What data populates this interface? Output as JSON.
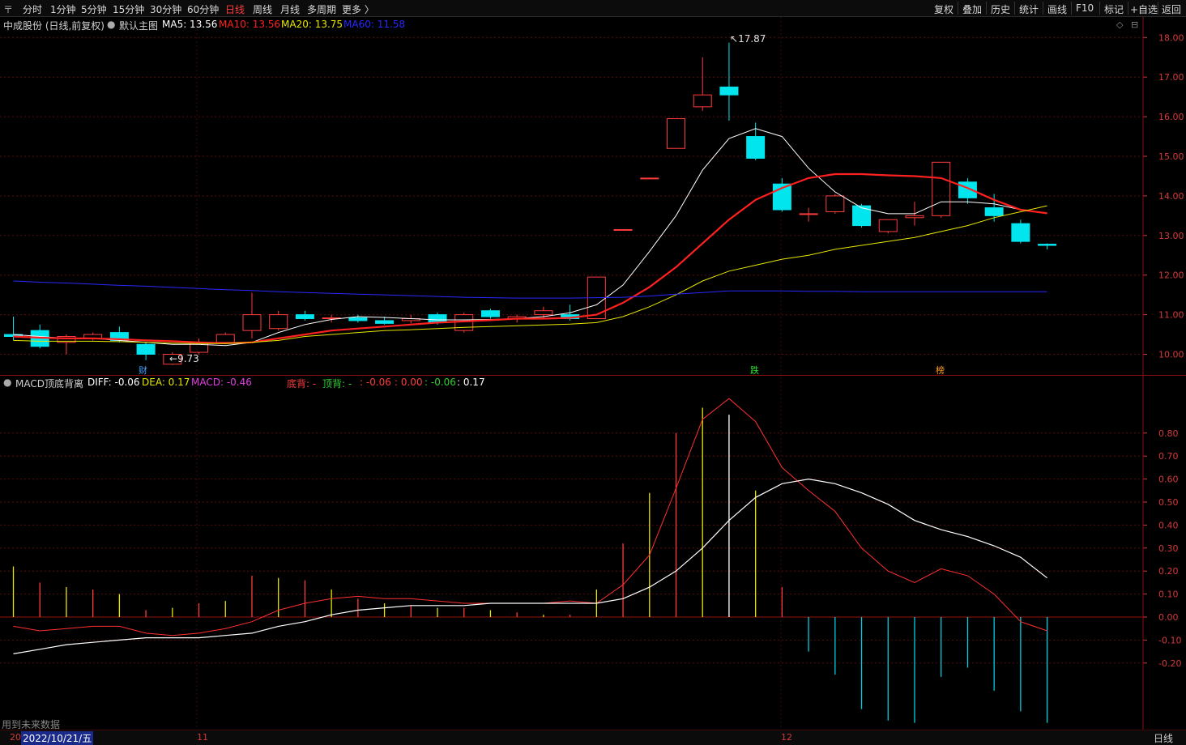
{
  "toolbar": {
    "menu_icon": "〒",
    "periods": [
      "分时",
      "1分钟",
      "5分钟",
      "15分钟",
      "30分钟",
      "60分钟",
      "日线",
      "周线",
      "月线",
      "多周期",
      "更多 〉"
    ],
    "active_period": "日线",
    "right_buttons": [
      "复权",
      "叠加",
      "历史",
      "统计",
      "画线",
      "F10",
      "标记",
      "+自选",
      "返回"
    ]
  },
  "main_legend": {
    "stock": "中成股份 (日线,前复权)",
    "template": "默认主图",
    "ma5": "MA5: 13.56",
    "ma10": "MA10: 13.56",
    "ma20": "MA20: 13.75",
    "ma60": "MA60: 11.58"
  },
  "macd_legend": {
    "name": "MACD顶底背离",
    "diff": "DIFF: -0.06",
    "dea": "DEA: 0.17",
    "macd": "MACD: -0.46",
    "bottom_div": "底背: -",
    "top_div": "顶背: -",
    "v1": ": -0.06",
    "v2": ": 0.00",
    "v3": ": -0.06",
    "v4": ": 0.17"
  },
  "annotations": {
    "high": "17.87",
    "low": "9.73",
    "badge1": "财",
    "badge2": "跌",
    "badge3": "榜"
  },
  "footer": {
    "note": "用到未来数据",
    "date_label": "2022/10/21/五",
    "month_11": "11",
    "month_12": "12",
    "period": "日线",
    "left_mark": "20"
  },
  "colors": {
    "up": "#ff3c3c",
    "down": "#00e5ee",
    "ma5": "#ffffff",
    "ma10": "#ff2020",
    "ma20": "#e6e600",
    "ma60": "#2828ff",
    "axis": "#d43a3a"
  },
  "chart_data": [
    {
      "type": "candlestick",
      "title": "中成股份 (日线,前复权)",
      "ylim": [
        9.6,
        18.2
      ],
      "y_ticks": [
        10.0,
        11.0,
        12.0,
        13.0,
        14.0,
        15.0,
        16.0,
        17.0,
        18.0
      ],
      "candles": [
        {
          "o": 10.5,
          "h": 10.95,
          "l": 10.35,
          "c": 10.45
        },
        {
          "o": 10.6,
          "h": 10.75,
          "l": 10.15,
          "c": 10.2
        },
        {
          "o": 10.3,
          "h": 10.5,
          "l": 10.0,
          "c": 10.45
        },
        {
          "o": 10.4,
          "h": 10.55,
          "l": 10.35,
          "c": 10.5
        },
        {
          "o": 10.55,
          "h": 10.7,
          "l": 10.3,
          "c": 10.35
        },
        {
          "o": 10.25,
          "h": 10.3,
          "l": 9.85,
          "c": 10.0
        },
        {
          "o": 9.75,
          "h": 10.05,
          "l": 9.73,
          "c": 10.0
        },
        {
          "o": 10.05,
          "h": 10.4,
          "l": 10.0,
          "c": 10.3
        },
        {
          "o": 10.3,
          "h": 10.55,
          "l": 10.25,
          "c": 10.5
        },
        {
          "o": 10.6,
          "h": 11.55,
          "l": 10.4,
          "c": 11.0
        },
        {
          "o": 10.65,
          "h": 11.1,
          "l": 10.6,
          "c": 11.0
        },
        {
          "o": 11.0,
          "h": 11.1,
          "l": 10.85,
          "c": 10.9
        },
        {
          "o": 10.9,
          "h": 11.0,
          "l": 10.8,
          "c": 10.92
        },
        {
          "o": 10.92,
          "h": 11.0,
          "l": 10.8,
          "c": 10.85
        },
        {
          "o": 10.85,
          "h": 10.95,
          "l": 10.75,
          "c": 10.78
        },
        {
          "o": 10.85,
          "h": 11.0,
          "l": 10.78,
          "c": 10.9
        },
        {
          "o": 11.0,
          "h": 11.05,
          "l": 10.75,
          "c": 10.8
        },
        {
          "o": 10.6,
          "h": 11.05,
          "l": 10.55,
          "c": 11.0
        },
        {
          "o": 11.1,
          "h": 11.15,
          "l": 10.9,
          "c": 10.95
        },
        {
          "o": 10.9,
          "h": 11.0,
          "l": 10.8,
          "c": 10.95
        },
        {
          "o": 11.0,
          "h": 11.2,
          "l": 10.9,
          "c": 11.1
        },
        {
          "o": 11.0,
          "h": 11.25,
          "l": 10.85,
          "c": 10.9
        },
        {
          "o": 10.9,
          "h": 11.95,
          "l": 10.9,
          "c": 11.95
        },
        {
          "o": 13.15,
          "h": 13.15,
          "l": 13.15,
          "c": 13.15
        },
        {
          "o": 14.45,
          "h": 14.45,
          "l": 14.45,
          "c": 14.45
        },
        {
          "o": 15.2,
          "h": 15.95,
          "l": 15.2,
          "c": 15.95
        },
        {
          "o": 16.25,
          "h": 17.5,
          "l": 16.15,
          "c": 16.55
        },
        {
          "o": 16.75,
          "h": 17.87,
          "l": 15.9,
          "c": 16.55
        },
        {
          "o": 15.5,
          "h": 15.85,
          "l": 14.9,
          "c": 14.95
        },
        {
          "o": 14.3,
          "h": 14.45,
          "l": 13.6,
          "c": 13.65
        },
        {
          "o": 13.55,
          "h": 13.7,
          "l": 13.35,
          "c": 13.55
        },
        {
          "o": 13.6,
          "h": 14.05,
          "l": 13.55,
          "c": 14.0
        },
        {
          "o": 13.75,
          "h": 13.8,
          "l": 13.2,
          "c": 13.25
        },
        {
          "o": 13.1,
          "h": 13.4,
          "l": 13.05,
          "c": 13.4
        },
        {
          "o": 13.45,
          "h": 13.85,
          "l": 13.25,
          "c": 13.5
        },
        {
          "o": 13.5,
          "h": 14.85,
          "l": 13.45,
          "c": 14.85
        },
        {
          "o": 14.35,
          "h": 14.45,
          "l": 13.8,
          "c": 13.95
        },
        {
          "o": 13.7,
          "h": 14.05,
          "l": 13.35,
          "c": 13.5
        },
        {
          "o": 13.3,
          "h": 13.4,
          "l": 12.8,
          "c": 12.85
        },
        {
          "o": 12.78,
          "h": 12.8,
          "l": 12.65,
          "c": 12.75
        }
      ],
      "series": [
        {
          "name": "MA5",
          "values": [
            10.5,
            10.45,
            10.4,
            10.4,
            10.35,
            10.3,
            10.25,
            10.25,
            10.22,
            10.3,
            10.55,
            10.75,
            10.88,
            10.95,
            10.93,
            10.9,
            10.87,
            10.87,
            10.88,
            10.9,
            10.95,
            11.05,
            11.25,
            11.75,
            12.6,
            13.5,
            14.65,
            15.45,
            15.7,
            15.5,
            14.7,
            14.1,
            13.7,
            13.55,
            13.55,
            13.85,
            13.85,
            13.8,
            13.65,
            13.56
          ]
        },
        {
          "name": "MA10",
          "values": [
            10.45,
            10.42,
            10.4,
            10.4,
            10.38,
            10.35,
            10.33,
            10.3,
            10.28,
            10.3,
            10.4,
            10.5,
            10.6,
            10.65,
            10.7,
            10.75,
            10.8,
            10.83,
            10.86,
            10.9,
            10.9,
            10.92,
            11.0,
            11.3,
            11.7,
            12.2,
            12.8,
            13.4,
            13.9,
            14.2,
            14.45,
            14.55,
            14.55,
            14.52,
            14.5,
            14.45,
            14.2,
            13.9,
            13.65,
            13.56
          ]
        },
        {
          "name": "MA20",
          "values": [
            10.35,
            10.33,
            10.33,
            10.33,
            10.32,
            10.3,
            10.28,
            10.27,
            10.27,
            10.3,
            10.35,
            10.45,
            10.5,
            10.55,
            10.6,
            10.62,
            10.65,
            10.68,
            10.7,
            10.72,
            10.74,
            10.76,
            10.8,
            10.95,
            11.2,
            11.5,
            11.85,
            12.1,
            12.25,
            12.4,
            12.5,
            12.65,
            12.75,
            12.85,
            12.95,
            13.1,
            13.25,
            13.45,
            13.6,
            13.75
          ]
        },
        {
          "name": "MA60",
          "values": [
            11.85,
            11.82,
            11.8,
            11.77,
            11.74,
            11.72,
            11.69,
            11.66,
            11.63,
            11.61,
            11.58,
            11.56,
            11.54,
            11.52,
            11.5,
            11.48,
            11.46,
            11.44,
            11.43,
            11.42,
            11.42,
            11.42,
            11.43,
            11.44,
            11.47,
            11.52,
            11.56,
            11.6,
            11.6,
            11.6,
            11.59,
            11.59,
            11.58,
            11.58,
            11.58,
            11.58,
            11.58,
            11.58,
            11.58,
            11.58
          ]
        }
      ]
    },
    {
      "type": "bar",
      "title": "MACD顶底背离",
      "ylim": [
        -0.45,
        0.95
      ],
      "y_ticks": [
        -0.2,
        -0.1,
        0.0,
        0.1,
        0.2,
        0.3,
        0.4,
        0.5,
        0.6,
        0.7,
        0.8
      ],
      "series": [
        {
          "name": "MACD",
          "values": [
            0.22,
            0.15,
            0.13,
            0.12,
            0.1,
            0.03,
            0.04,
            0.06,
            0.07,
            0.18,
            0.17,
            0.16,
            0.12,
            0.08,
            0.06,
            0.05,
            0.04,
            0.04,
            0.03,
            0.02,
            0.01,
            0.01,
            0.12,
            0.32,
            0.54,
            0.8,
            0.91,
            0.88,
            0.55,
            0.13,
            -0.15,
            -0.25,
            -0.4,
            -0.45,
            -0.46,
            -0.26,
            -0.22,
            -0.32,
            -0.41,
            -0.46
          ]
        },
        {
          "name": "DIFF",
          "values": [
            -0.04,
            -0.06,
            -0.05,
            -0.04,
            -0.04,
            -0.07,
            -0.08,
            -0.07,
            -0.05,
            -0.02,
            0.03,
            0.06,
            0.08,
            0.09,
            0.08,
            0.08,
            0.07,
            0.06,
            0.06,
            0.06,
            0.06,
            0.07,
            0.06,
            0.14,
            0.27,
            0.56,
            0.86,
            0.95,
            0.85,
            0.65,
            0.55,
            0.46,
            0.3,
            0.2,
            0.15,
            0.21,
            0.18,
            0.1,
            -0.02,
            -0.06
          ]
        },
        {
          "name": "DEA",
          "values": [
            -0.16,
            -0.14,
            -0.12,
            -0.11,
            -0.1,
            -0.09,
            -0.09,
            -0.09,
            -0.08,
            -0.07,
            -0.04,
            -0.02,
            0.01,
            0.03,
            0.04,
            0.05,
            0.05,
            0.05,
            0.06,
            0.06,
            0.06,
            0.06,
            0.06,
            0.08,
            0.13,
            0.2,
            0.3,
            0.42,
            0.52,
            0.58,
            0.6,
            0.58,
            0.54,
            0.49,
            0.42,
            0.38,
            0.35,
            0.31,
            0.26,
            0.17
          ]
        }
      ]
    }
  ]
}
